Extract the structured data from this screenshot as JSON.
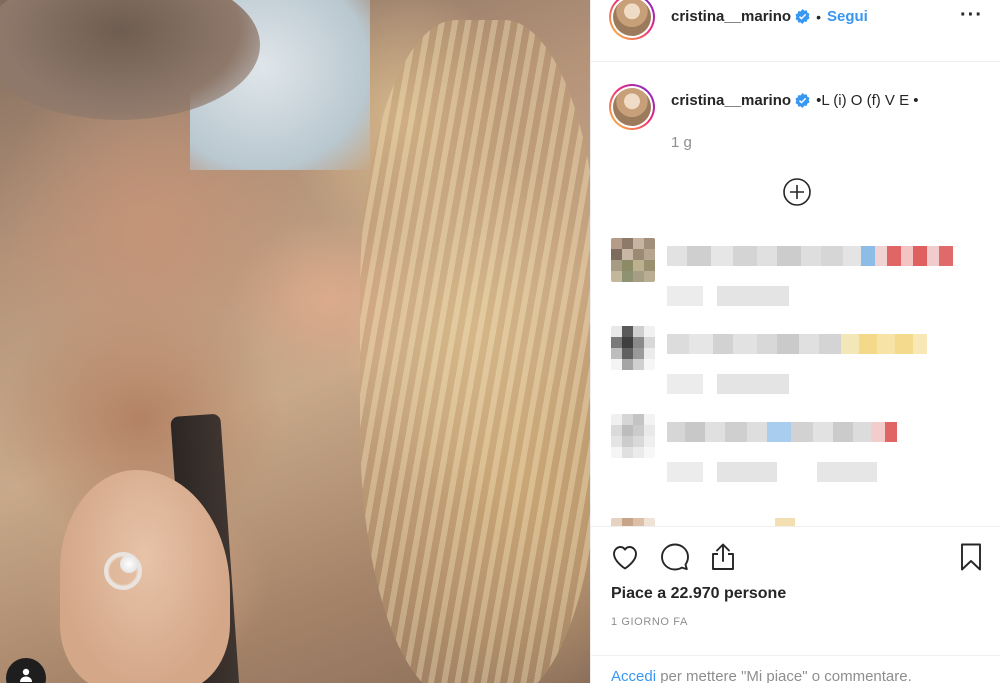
{
  "post": {
    "username": "cristina__marino",
    "separator": "•",
    "follow_label": "Segui",
    "more_icon": "more-options-icon",
    "caption_text": "•L (i) O (f) V E •",
    "caption_time": "1 g",
    "load_more_icon": "plus-circle-icon"
  },
  "actions": {
    "likes_text": "Piace a 22.970 persone",
    "posted_label": "1 GIORNO FA",
    "login_link": "Accedi",
    "login_rest": " per mettere \"Mi piace\" o commentare."
  },
  "colors": {
    "accent": "#3897f0",
    "text": "#262626",
    "muted": "#8e8e8e",
    "border": "#efefef"
  }
}
